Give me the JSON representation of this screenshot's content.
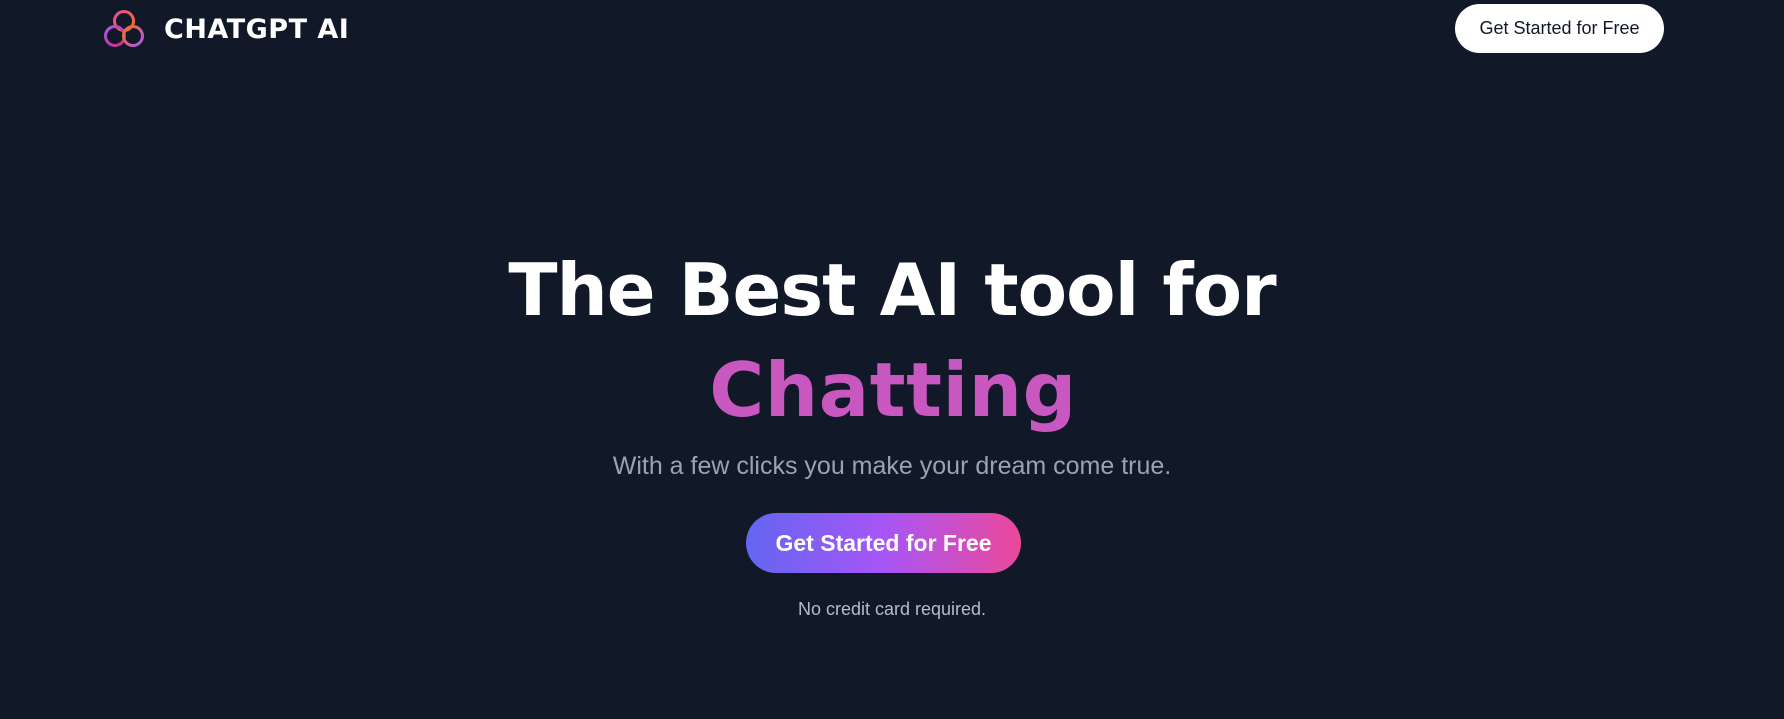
{
  "header": {
    "logo_text": "CHATGPT AI",
    "logo_icon": "interlocking-rings-icon",
    "cta_label": "Get Started for Free"
  },
  "hero": {
    "title_line1": "The Best AI tool for",
    "title_line2": "Chatting",
    "subtitle": "With a few clicks you make your dream come true.",
    "cta_label": "Get Started for Free",
    "note": "No credit card required."
  },
  "colors": {
    "background": "#111827",
    "accent_text": "#c957c0",
    "gradient_start": "#6366f1",
    "gradient_mid": "#a855f7",
    "gradient_end": "#ec4899"
  }
}
